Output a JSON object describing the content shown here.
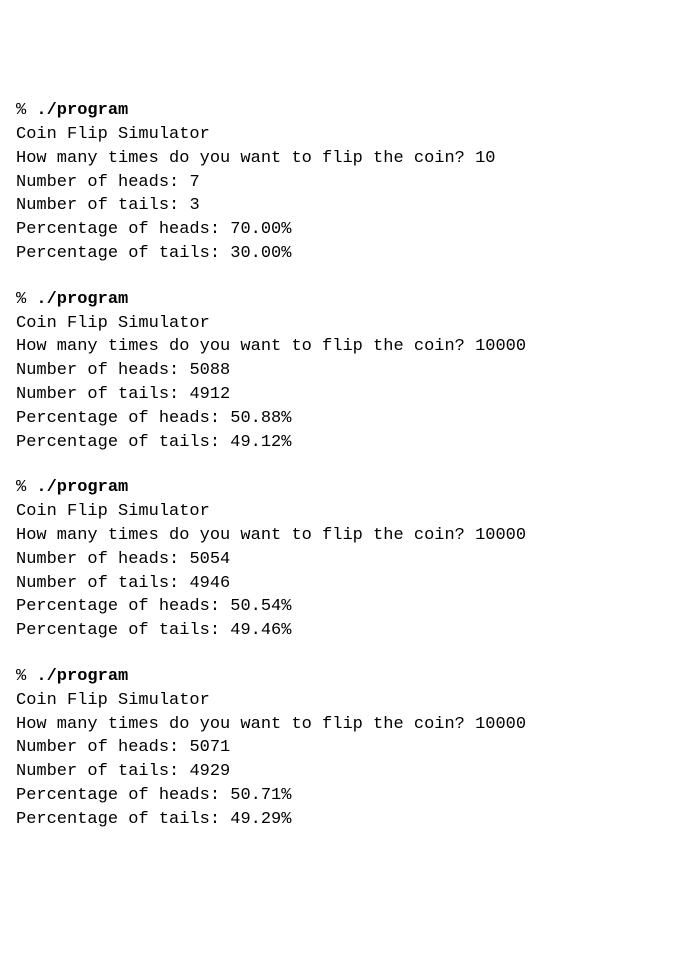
{
  "runs": [
    {
      "prompt_prefix": "% ",
      "command": "./program",
      "title": "Coin Flip Simulator",
      "question": "How many times do you want to flip the coin? ",
      "input_value": "10",
      "heads_label": "Number of heads: ",
      "heads_value": "7",
      "tails_label": "Number of tails: ",
      "tails_value": "3",
      "pct_heads_label": "Percentage of heads: ",
      "pct_heads_value": "70.00%",
      "pct_tails_label": "Percentage of tails: ",
      "pct_tails_value": "30.00%"
    },
    {
      "prompt_prefix": "% ",
      "command": "./program",
      "title": "Coin Flip Simulator",
      "question": "How many times do you want to flip the coin? ",
      "input_value": "10000",
      "heads_label": "Number of heads: ",
      "heads_value": "5088",
      "tails_label": "Number of tails: ",
      "tails_value": "4912",
      "pct_heads_label": "Percentage of heads: ",
      "pct_heads_value": "50.88%",
      "pct_tails_label": "Percentage of tails: ",
      "pct_tails_value": "49.12%"
    },
    {
      "prompt_prefix": "% ",
      "command": "./program",
      "title": "Coin Flip Simulator",
      "question": "How many times do you want to flip the coin? ",
      "input_value": "10000",
      "heads_label": "Number of heads: ",
      "heads_value": "5054",
      "tails_label": "Number of tails: ",
      "tails_value": "4946",
      "pct_heads_label": "Percentage of heads: ",
      "pct_heads_value": "50.54%",
      "pct_tails_label": "Percentage of tails: ",
      "pct_tails_value": "49.46%"
    },
    {
      "prompt_prefix": "% ",
      "command": "./program",
      "title": "Coin Flip Simulator",
      "question": "How many times do you want to flip the coin? ",
      "input_value": "10000",
      "heads_label": "Number of heads: ",
      "heads_value": "5071",
      "tails_label": "Number of tails: ",
      "tails_value": "4929",
      "pct_heads_label": "Percentage of heads: ",
      "pct_heads_value": "50.71%",
      "pct_tails_label": "Percentage of tails: ",
      "pct_tails_value": "49.29%"
    }
  ]
}
